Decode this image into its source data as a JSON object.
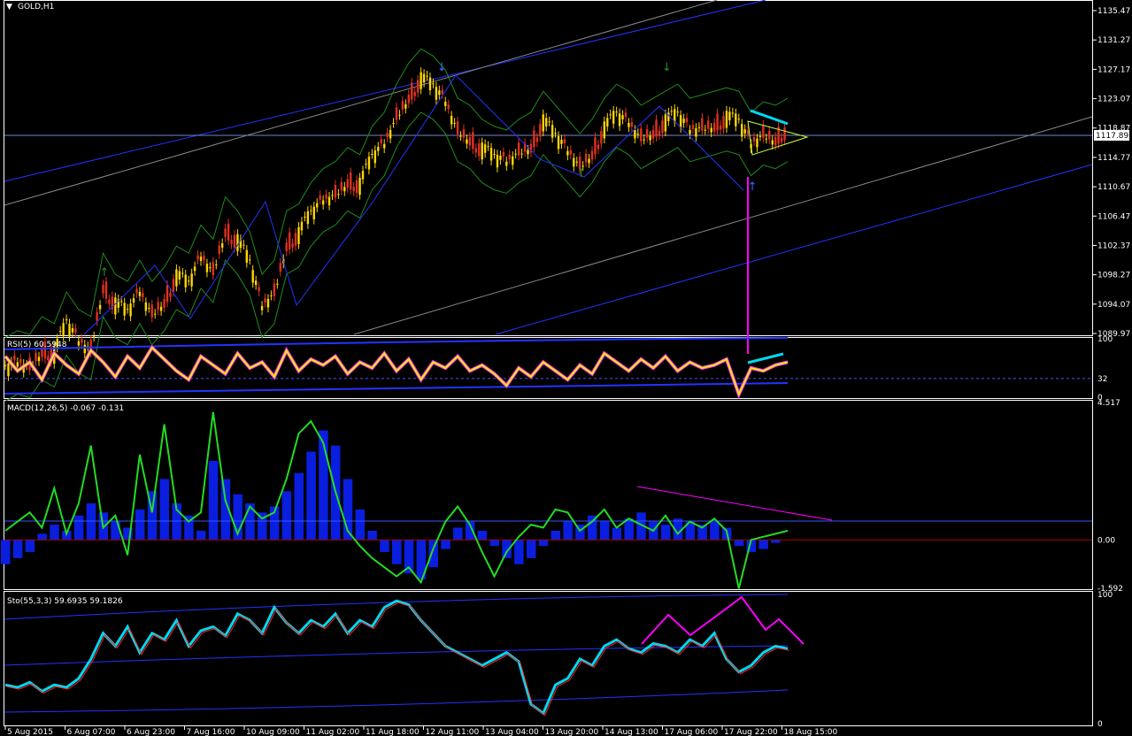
{
  "window": {
    "symbol_label": "GOLD,H1"
  },
  "colors": {
    "background": "#000000",
    "frame": "#ffffff",
    "bull_candle": "#ffd700",
    "bear_candle": "#e0311f",
    "bands": "#1e8c1e",
    "trend_lines": "#2233ff",
    "channel_white": "#888888",
    "annotation": "#ff00ff",
    "cyan": "#00d8f0",
    "macd_hist": "#0a1ee0",
    "macd_line": "#22dd22",
    "rsi_line": "#ffee00",
    "price_line": "#6f86c7"
  },
  "chart_data": [
    {
      "type": "line",
      "title": "GOLD,H1",
      "chart": "candlestick",
      "current_price": "1117.89",
      "ylim": [
        1089.97,
        1137.2
      ],
      "y_ticks": [
        "1135.47",
        "1131.27",
        "1127.17",
        "1123.07",
        "1118.87",
        "1114.77",
        "1110.67",
        "1106.47",
        "1102.37",
        "1098.27",
        "1094.07",
        "1089.97"
      ],
      "x_ticks": [
        "5 Aug 2015",
        "6 Aug 07:00",
        "6 Aug 23:00",
        "7 Aug 16:00",
        "10 Aug 09:00",
        "11 Aug 02:00",
        "11 Aug 18:00",
        "12 Aug 11:00",
        "13 Aug 04:00",
        "13 Aug 20:00",
        "14 Aug 13:00",
        "17 Aug 06:00",
        "17 Aug 22:00",
        "18 Aug 15:00"
      ],
      "close_path": [
        [
          0,
          1085
        ],
        [
          10,
          1086
        ],
        [
          20,
          1085.5
        ],
        [
          30,
          1088
        ],
        [
          40,
          1087
        ],
        [
          50,
          1091.5
        ],
        [
          60,
          1089
        ],
        [
          70,
          1088
        ],
        [
          80,
          1097
        ],
        [
          90,
          1094
        ],
        [
          100,
          1093
        ],
        [
          110,
          1096
        ],
        [
          120,
          1093
        ],
        [
          130,
          1095
        ],
        [
          140,
          1098
        ],
        [
          150,
          1097
        ],
        [
          160,
          1101
        ],
        [
          170,
          1099
        ],
        [
          180,
          1105
        ],
        [
          190,
          1103
        ],
        [
          200,
          1100
        ],
        [
          210,
          1094
        ],
        [
          220,
          1096
        ],
        [
          230,
          1103
        ],
        [
          240,
          1104
        ],
        [
          250,
          1107
        ],
        [
          260,
          1109
        ],
        [
          270,
          1110
        ],
        [
          280,
          1112
        ],
        [
          290,
          1111
        ],
        [
          300,
          1115
        ],
        [
          310,
          1117
        ],
        [
          320,
          1121
        ],
        [
          330,
          1124
        ],
        [
          340,
          1126
        ],
        [
          350,
          1125
        ],
        [
          360,
          1123
        ],
        [
          370,
          1119
        ],
        [
          380,
          1118
        ],
        [
          390,
          1116
        ],
        [
          400,
          1115
        ],
        [
          410,
          1114.5
        ],
        [
          420,
          1116
        ],
        [
          430,
          1117
        ],
        [
          440,
          1120
        ],
        [
          450,
          1118
        ],
        [
          460,
          1116
        ],
        [
          470,
          1114
        ],
        [
          480,
          1116
        ],
        [
          490,
          1119
        ],
        [
          500,
          1121
        ],
        [
          510,
          1120
        ],
        [
          520,
          1118
        ],
        [
          530,
          1119
        ],
        [
          540,
          1120
        ],
        [
          550,
          1121
        ],
        [
          560,
          1119
        ],
        [
          570,
          1119.5
        ],
        [
          580,
          1120
        ],
        [
          590,
          1120.5
        ],
        [
          600,
          1120
        ],
        [
          610,
          1117
        ],
        [
          620,
          1118.5
        ],
        [
          630,
          1118
        ],
        [
          640,
          1119
        ]
      ],
      "bands": {
        "upper_offset": 4.5,
        "lower_offset": -4.5
      },
      "markers": [
        {
          "t": 80,
          "kind": "up-green"
        },
        {
          "t": 356,
          "kind": "down-blue"
        },
        {
          "t": 470,
          "kind": "up-green"
        },
        {
          "t": 540,
          "kind": "down-green"
        },
        {
          "t": 610,
          "kind": "up-blue"
        }
      ]
    },
    {
      "type": "line",
      "title": "RSI(5) 60.5948",
      "ylim": [
        0,
        100
      ],
      "y_ticks": [
        "100",
        "32",
        "0"
      ],
      "level": 32,
      "series": [
        {
          "values": [
            70,
            45,
            60,
            30,
            75,
            55,
            40,
            80,
            60,
            35,
            70,
            50,
            85,
            65,
            45,
            30,
            70,
            55,
            40,
            75,
            50,
            60,
            35,
            80,
            45,
            65,
            55,
            70,
            40,
            60,
            50,
            75,
            45,
            65,
            30,
            60,
            50,
            70,
            45,
            55,
            40,
            20,
            50,
            35,
            60,
            45,
            30,
            55,
            40,
            75,
            60,
            45,
            65,
            50,
            70,
            45,
            60,
            50,
            55,
            65,
            5,
            50,
            45,
            55,
            60
          ]
        }
      ]
    },
    {
      "type": "bar",
      "title": "MACD(12,26,5) -0.067 -0.131",
      "ylim": [
        -1.592,
        4.517
      ],
      "y_ticks": [
        "4.517",
        "0.00",
        "-1.592"
      ],
      "series": [
        {
          "name": "hist",
          "values": [
            -0.8,
            -0.6,
            -0.4,
            0.2,
            0.5,
            0.3,
            0.8,
            1.2,
            0.9,
            0.6,
            0.4,
            1.0,
            1.6,
            2.0,
            1.2,
            0.8,
            0.3,
            2.6,
            2.0,
            1.5,
            1.2,
            0.9,
            1.1,
            1.6,
            2.2,
            2.9,
            3.6,
            3.1,
            2.0,
            1.0,
            0.3,
            -0.4,
            -0.8,
            -1.1,
            -1.3,
            -0.9,
            -0.3,
            0.4,
            0.6,
            0.3,
            -0.2,
            -0.6,
            -0.8,
            -0.6,
            -0.2,
            0.3,
            0.6,
            0.5,
            0.8,
            0.6,
            0.4,
            0.7,
            0.9,
            0.6,
            0.5,
            0.7,
            0.6,
            0.5,
            0.6,
            0.4,
            -0.2,
            -0.4,
            -0.3,
            -0.1,
            0.0
          ]
        },
        {
          "name": "signal",
          "values": [
            0.3,
            0.6,
            0.9,
            0.4,
            1.7,
            0.2,
            1.2,
            3.1,
            0.4,
            0.8,
            -0.5,
            2.8,
            0.9,
            3.8,
            1.0,
            0.6,
            0.9,
            4.2,
            1.3,
            0.2,
            1.1,
            0.7,
            0.9,
            2.0,
            3.5,
            3.9,
            3.2,
            1.6,
            0.3,
            -0.2,
            -0.6,
            -0.9,
            -1.2,
            -0.9,
            -1.4,
            -0.3,
            0.6,
            1.1,
            0.5,
            -0.4,
            -1.2,
            -0.4,
            0.1,
            0.5,
            0.4,
            1.0,
            0.9,
            0.3,
            0.6,
            1.0,
            0.4,
            0.7,
            0.5,
            0.3,
            0.8,
            0.2,
            0.6,
            0.4,
            0.7,
            0.3,
            -1.6,
            0.0,
            0.1,
            0.2,
            0.3
          ]
        }
      ]
    },
    {
      "type": "line",
      "title": "Sto(55,3,3) 59.6935 59.1826",
      "ylim": [
        0,
        100
      ],
      "y_ticks": [
        "100",
        "0"
      ],
      "series": [
        {
          "values": [
            30,
            28,
            32,
            25,
            30,
            28,
            35,
            50,
            70,
            60,
            75,
            55,
            70,
            65,
            80,
            60,
            72,
            75,
            68,
            85,
            80,
            70,
            90,
            78,
            70,
            80,
            75,
            85,
            70,
            80,
            75,
            90,
            95,
            92,
            80,
            70,
            60,
            55,
            50,
            45,
            50,
            55,
            48,
            15,
            8,
            30,
            35,
            50,
            45,
            60,
            65,
            58,
            55,
            62,
            60,
            55,
            65,
            60,
            70,
            50,
            40,
            45,
            55,
            60,
            58
          ]
        }
      ]
    }
  ]
}
